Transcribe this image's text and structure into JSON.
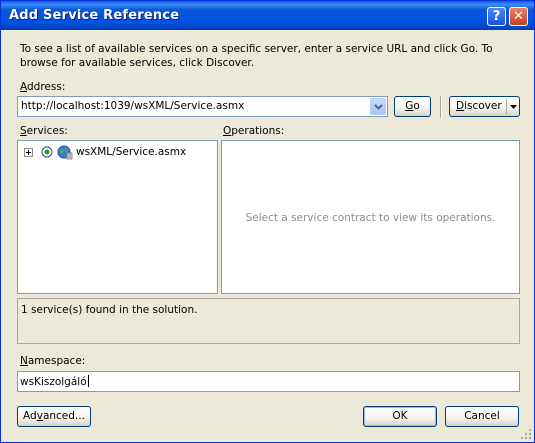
{
  "window": {
    "title": "Add Service Reference",
    "help_glyph": "?",
    "close_glyph": "✕"
  },
  "description": "To see a list of available services on a specific server, enter a service URL and click Go. To browse for available services, click Discover.",
  "address": {
    "label_mnemonic": "A",
    "label_rest": "ddress:",
    "value": "http://localhost:1039/wsXML/Service.asmx"
  },
  "buttons": {
    "go_mnemonic": "G",
    "go_rest": "o",
    "discover_mnemonic": "D",
    "discover_rest": "iscover",
    "advanced_first": "Ad",
    "advanced_mnemonic": "v",
    "advanced_rest": "anced...",
    "ok": "OK",
    "cancel": "Cancel"
  },
  "services": {
    "label_mnemonic": "S",
    "label_rest": "ervices:",
    "items": [
      {
        "label": "wsXML/Service.asmx",
        "icon": "web-service-globe-icon"
      }
    ]
  },
  "operations": {
    "label_mnemonic": "O",
    "label_rest": "perations:",
    "placeholder": "Select a service contract to view its operations."
  },
  "status": {
    "text": "1 service(s) found in the solution."
  },
  "namespace": {
    "label_mnemonic": "N",
    "label_rest": "amespace:",
    "value": "wsKiszolgáló"
  },
  "colors": {
    "title_bar": "#0053e1",
    "dialog_background": "#ece9d8",
    "input_border": "#7f9db9",
    "placeholder_text": "#8c8c8c"
  }
}
